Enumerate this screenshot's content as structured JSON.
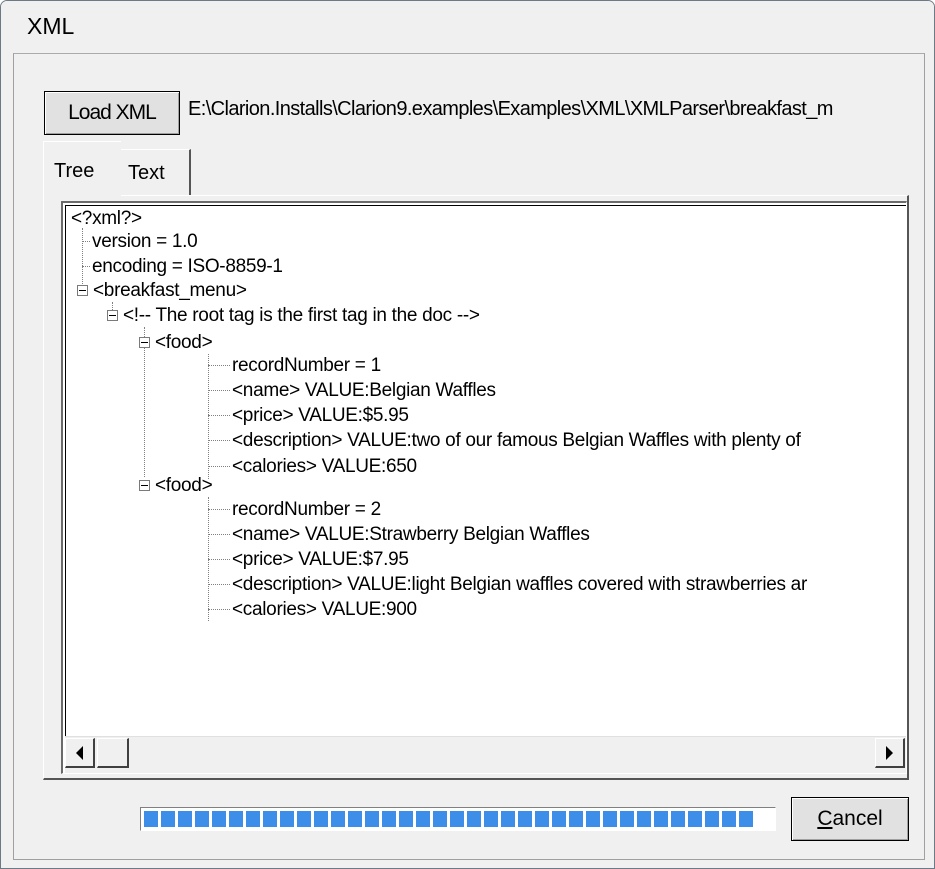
{
  "window": {
    "title": "XML"
  },
  "toolbar": {
    "load_label": "Load XML",
    "file_path": "E:\\Clarion.Installs\\Clarion9.examples\\Examples\\XML\\XMLParser\\breakfast_m"
  },
  "tabs": [
    {
      "label": "Tree",
      "selected": true
    },
    {
      "label": "Text",
      "selected": false
    }
  ],
  "tree": {
    "root": "<?xml?>",
    "version": "version = 1.0",
    "encoding": "encoding = ISO-8859-1",
    "menu": "<breakfast_menu>",
    "comment": "<!-- The root tag is the first tag in the doc -->",
    "food1": {
      "label": "<food>",
      "record": "recordNumber = 1",
      "name": "<name> VALUE:Belgian Waffles",
      "price": "<price> VALUE:$5.95",
      "description": "<description> VALUE:two of our famous Belgian Waffles with plenty of",
      "calories": "<calories> VALUE:650"
    },
    "food2": {
      "label": "<food>",
      "record": "recordNumber = 2",
      "name": "<name> VALUE:Strawberry Belgian Waffles",
      "price": "<price> VALUE:$7.95",
      "description": "<description> VALUE:light Belgian waffles covered with strawberries ar",
      "calories": "<calories> VALUE:900"
    }
  },
  "scrollbar": {
    "left_icon": "arrow-left-icon",
    "right_icon": "arrow-right-icon"
  },
  "progress": {
    "value": 1.0,
    "color": "#3d8ee8"
  },
  "footer": {
    "cancel_label_accel": "C",
    "cancel_label_rest": "ancel"
  }
}
